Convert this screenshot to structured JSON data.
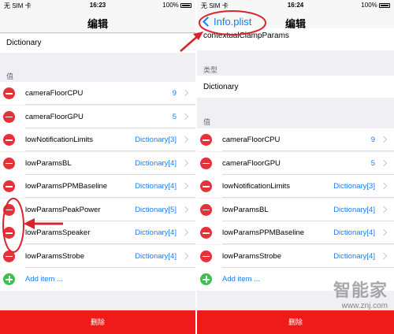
{
  "status_bar": {
    "carrier": "无 SIM 卡",
    "battery": "100%"
  },
  "left": {
    "time": "16:23",
    "nav_title": "编辑",
    "type_value": "Dictionary",
    "values_section": "值",
    "rows": [
      {
        "key": "cameraFloorCPU",
        "value": "9"
      },
      {
        "key": "cameraFloorGPU",
        "value": "5"
      },
      {
        "key": "lowNotificationLimits",
        "value": "Dictionary[3]"
      },
      {
        "key": "lowParamsBL",
        "value": "Dictionary[4]"
      },
      {
        "key": "lowParamsPPMBaseline",
        "value": "Dictionary[4]"
      },
      {
        "key": "lowParamsPeakPower",
        "value": "Dictionary[5]"
      },
      {
        "key": "lowParamsSpeaker",
        "value": "Dictionary[4]"
      },
      {
        "key": "lowParamsStrobe",
        "value": "Dictionary[4]"
      }
    ],
    "add_item": "Add item ...",
    "delete": "删除"
  },
  "right": {
    "time": "16:24",
    "back_label": "Info.plist",
    "nav_title": "编辑",
    "key_name": "contextualClampParams",
    "type_section": "类型",
    "type_value": "Dictionary",
    "values_section": "值",
    "rows": [
      {
        "key": "cameraFloorCPU",
        "value": "9"
      },
      {
        "key": "cameraFloorGPU",
        "value": "5"
      },
      {
        "key": "lowNotificationLimits",
        "value": "Dictionary[3]"
      },
      {
        "key": "lowParamsBL",
        "value": "Dictionary[4]"
      },
      {
        "key": "lowParamsPPMBaseline",
        "value": "Dictionary[4]"
      },
      {
        "key": "lowParamsStrobe",
        "value": "Dictionary[4]"
      }
    ],
    "add_item": "Add item ...",
    "delete": "删除"
  },
  "watermark": {
    "brand": "智能家",
    "url": "www.znj.com"
  },
  "colors": {
    "accent": "#1a7cf7",
    "delete_red": "#ef1b1b",
    "minus_red": "#e4323b",
    "add_green": "#3ac24c",
    "annotation_red": "#d9232d"
  }
}
